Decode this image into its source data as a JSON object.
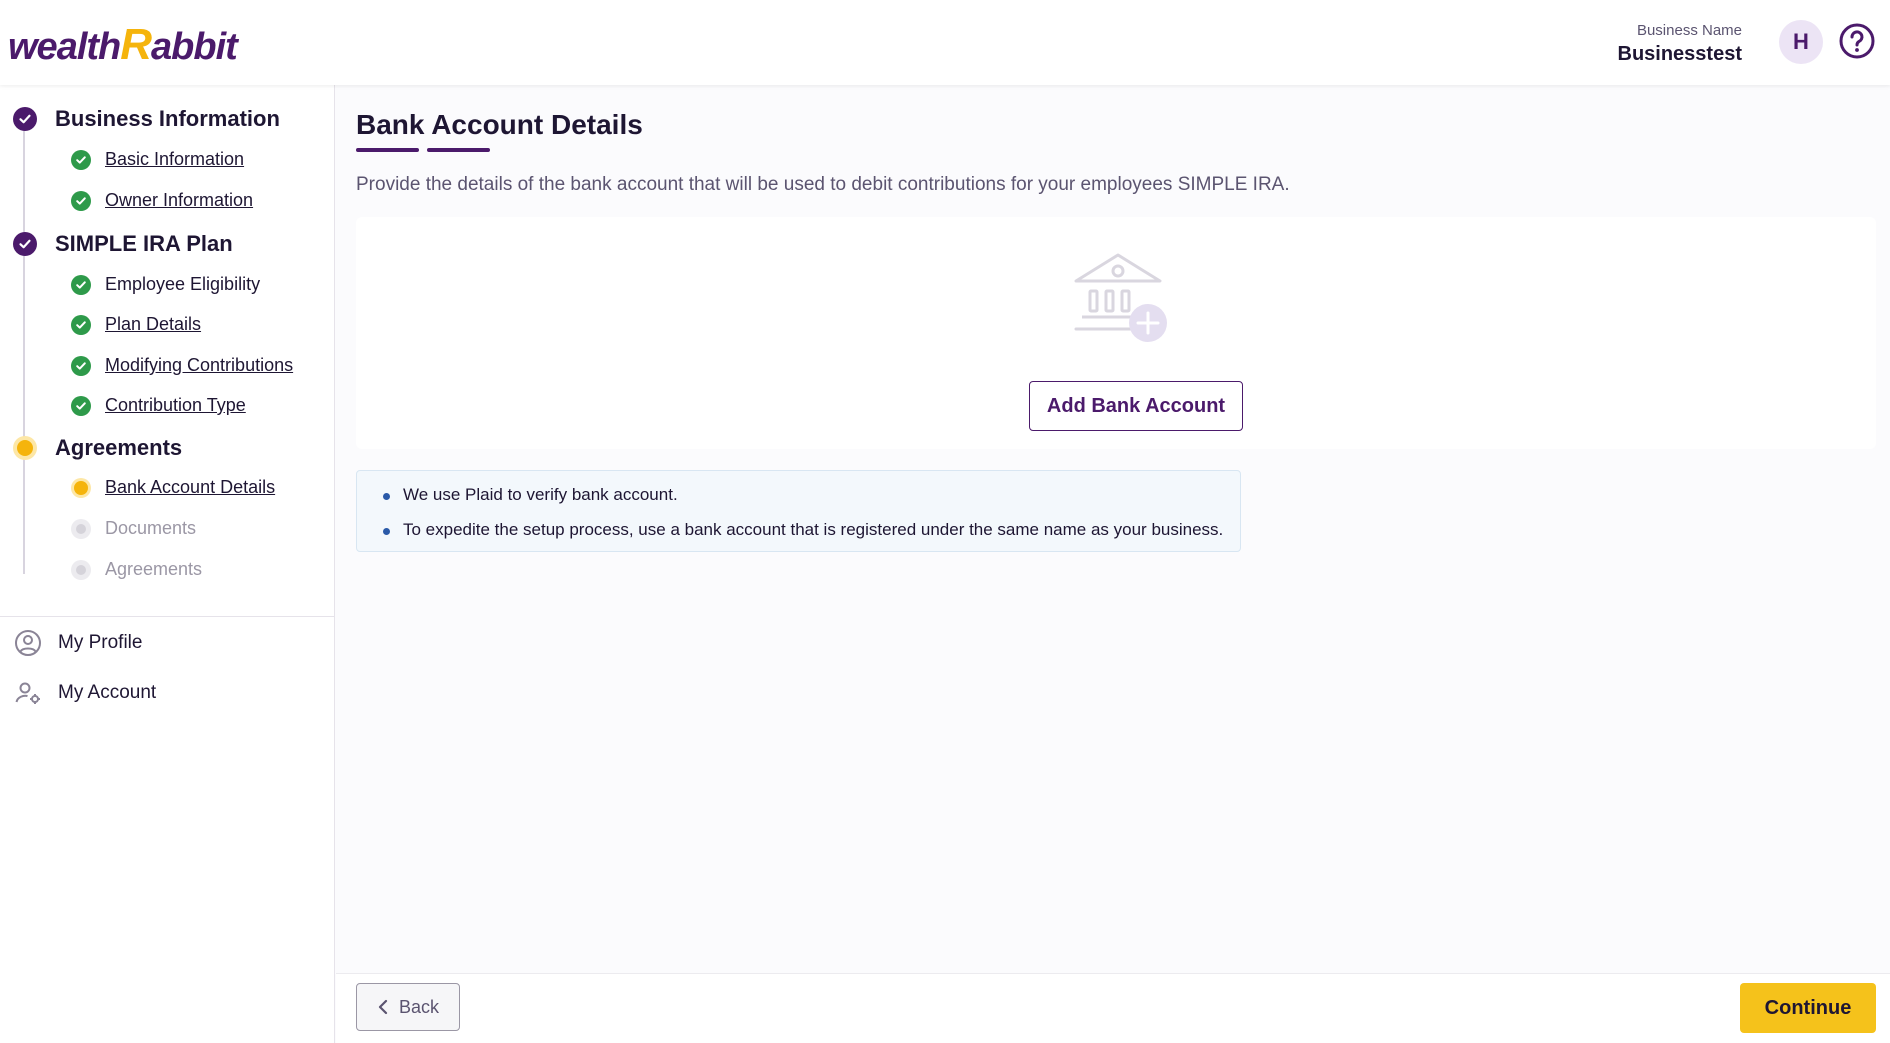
{
  "brand": {
    "logo_left": "wealth",
    "logo_r": "R",
    "logo_right": "abbit"
  },
  "header": {
    "business_label": "Business Name",
    "business_name": "Businesstest",
    "avatar_initial": "H",
    "help_icon": "question-circle-icon"
  },
  "sidebar": {
    "sections": [
      {
        "title": "Business Information",
        "status": "done",
        "steps": [
          {
            "label": "Basic Information",
            "status": "done"
          },
          {
            "label": "Owner Information",
            "status": "done"
          }
        ]
      },
      {
        "title": "SIMPLE IRA Plan",
        "status": "done",
        "steps": [
          {
            "label": "Employee Eligibility",
            "status": "done"
          },
          {
            "label": "Plan Details",
            "status": "done"
          },
          {
            "label": "Modifying Contributions",
            "status": "done"
          },
          {
            "label": "Contribution Type",
            "status": "done"
          }
        ]
      },
      {
        "title": "Agreements",
        "status": "current",
        "steps": [
          {
            "label": "Bank Account Details",
            "status": "current"
          },
          {
            "label": "Documents",
            "status": "pending"
          },
          {
            "label": "Agreements",
            "status": "pending"
          }
        ]
      }
    ],
    "menu": [
      {
        "label": "My Profile",
        "icon": "user-circle-icon"
      },
      {
        "label": "My Account",
        "icon": "user-gear-icon"
      }
    ]
  },
  "main": {
    "title": "Bank Account Details",
    "description": "Provide the details of the bank account that will be used to debit contributions for your employees SIMPLE IRA.",
    "illustration_icon": "bank-add-icon",
    "add_button": "Add Bank Account",
    "notes": [
      "We use Plaid to verify bank account.",
      "To expedite the setup process, use a bank account that is registered under the same name as your business."
    ]
  },
  "footer": {
    "back_label": "Back",
    "continue_label": "Continue"
  },
  "colors": {
    "brand_purple": "#4b1a6b",
    "accent_yellow": "#f5b40c",
    "success_green": "#2e9a4a"
  }
}
